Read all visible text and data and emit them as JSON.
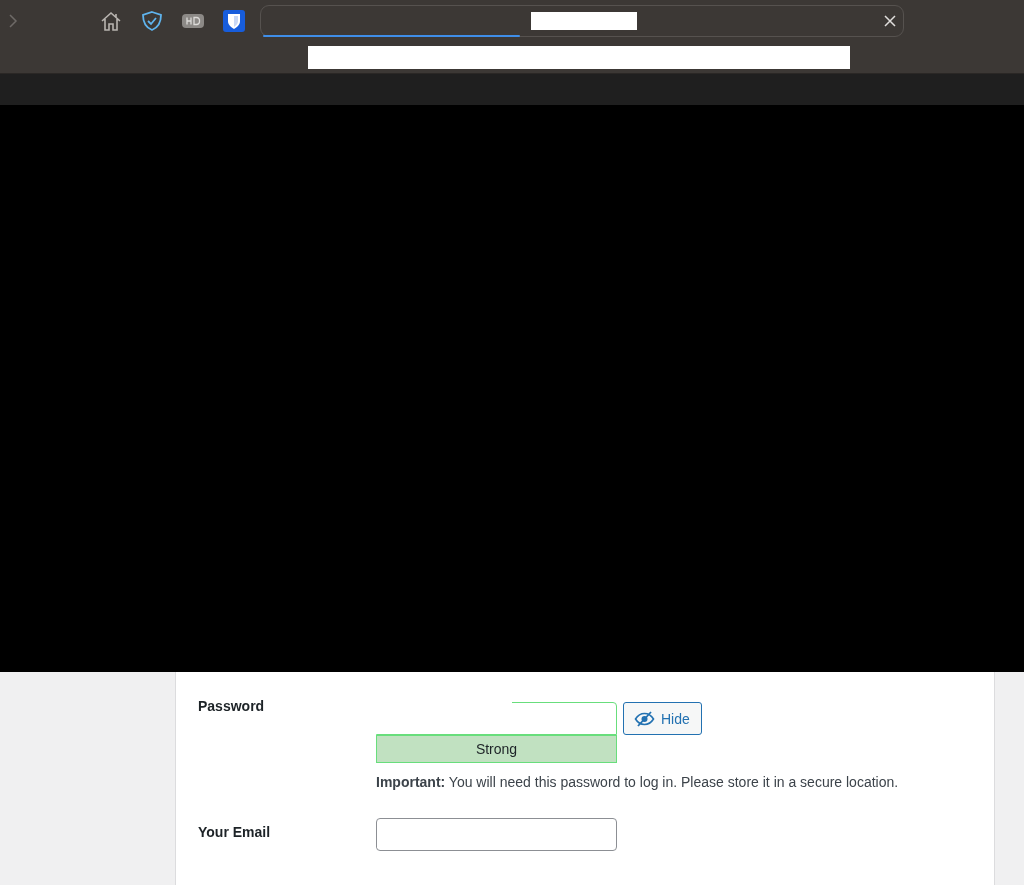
{
  "toolbar": {
    "address_bar": {
      "loading_bar": {
        "level": 0.4
      }
    }
  },
  "form": {
    "password": {
      "label": "Password",
      "toggle_button": "Hide",
      "strength": {
        "kind": "strong",
        "label": "Strong"
      },
      "notice": "**Important:** You will need this password to log in. Please store it in a secure location."
    },
    "email": {
      "label": "Your Email"
    }
  }
}
